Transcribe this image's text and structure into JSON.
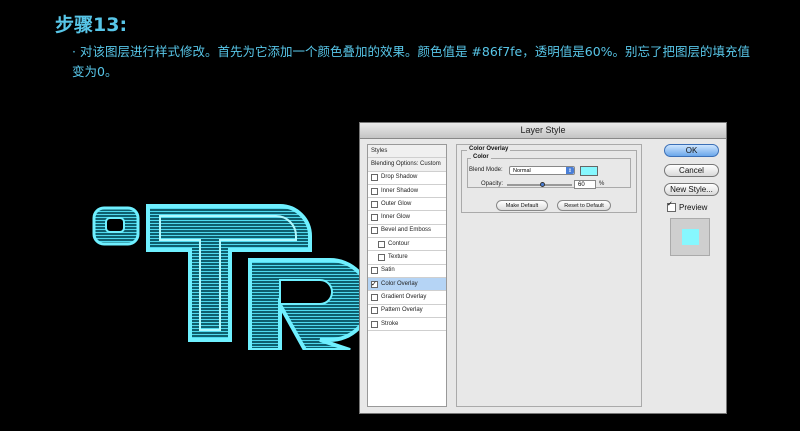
{
  "step": {
    "title": "步骤13:",
    "description": "· 对该图层进行样式修改。首先为它添加一个颜色叠加的效果。颜色值是 #86f7fe，透明值是60%。别忘了把图层的填充值变为0。"
  },
  "dialog": {
    "title": "Layer Style",
    "styles_list": [
      {
        "label": "Styles",
        "type": "head"
      },
      {
        "label": "Blending Options: Custom",
        "type": "head"
      },
      {
        "label": "Drop Shadow",
        "checked": false
      },
      {
        "label": "Inner Shadow",
        "checked": false
      },
      {
        "label": "Outer Glow",
        "checked": false
      },
      {
        "label": "Inner Glow",
        "checked": false
      },
      {
        "label": "Bevel and Emboss",
        "checked": false
      },
      {
        "label": "Contour",
        "checked": false,
        "sub": true
      },
      {
        "label": "Texture",
        "checked": false,
        "sub": true
      },
      {
        "label": "Satin",
        "checked": false
      },
      {
        "label": "Color Overlay",
        "checked": true,
        "selected": true
      },
      {
        "label": "Gradient Overlay",
        "checked": false
      },
      {
        "label": "Pattern Overlay",
        "checked": false
      },
      {
        "label": "Stroke",
        "checked": false
      }
    ],
    "section_title": "Color Overlay",
    "group_title": "Color",
    "blend_mode_label": "Blend Mode:",
    "blend_mode_value": "Normal",
    "overlay_color": "#86f7fe",
    "opacity_label": "Opacity:",
    "opacity_value": "60",
    "opacity_unit": "%",
    "make_default": "Make Default",
    "reset_default": "Reset to Default",
    "ok": "OK",
    "cancel": "Cancel",
    "new_style": "New Style...",
    "preview_label": "Preview",
    "preview_checked": true
  },
  "colors": {
    "accent_text": "#58c6e8",
    "neon": "#3fd6ec"
  }
}
